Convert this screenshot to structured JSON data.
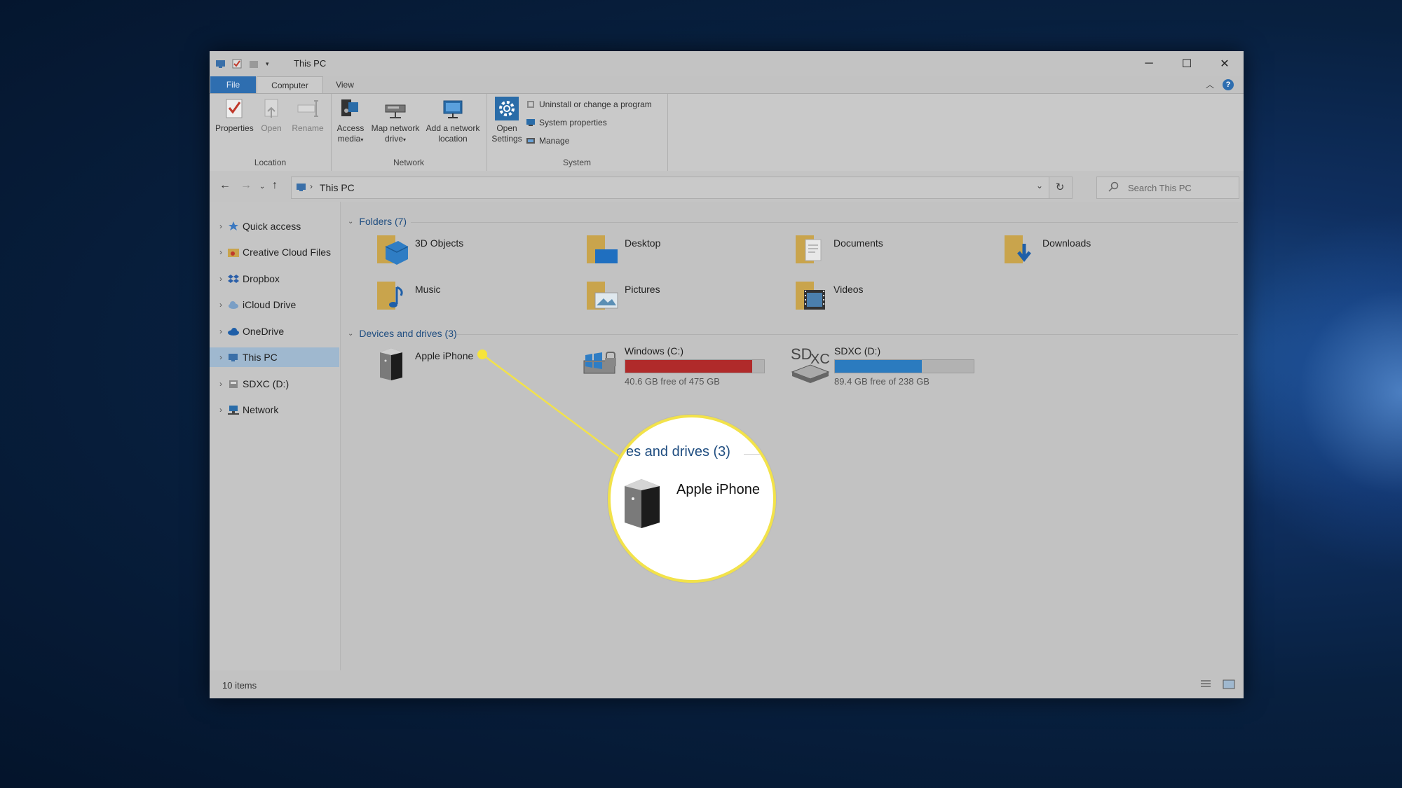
{
  "window": {
    "title": "This PC",
    "minimize_glyph": "─",
    "maximize_glyph": "☐",
    "close_glyph": "✕"
  },
  "ribbon": {
    "tabs": [
      "File",
      "Computer",
      "View"
    ],
    "help_label": "?",
    "location": {
      "label": "Location",
      "buttons": [
        "Properties",
        "Open",
        "Rename"
      ]
    },
    "network": {
      "label": "Network",
      "access_media": "Access media",
      "map_drive": "Map network drive",
      "add_location": "Add a network location"
    },
    "system": {
      "label": "System",
      "open_settings": "Open Settings",
      "uninstall": "Uninstall or change a program",
      "system_properties": "System properties",
      "manage": "Manage"
    }
  },
  "address": {
    "path": "This PC",
    "search_placeholder": "Search This PC"
  },
  "sidebar": {
    "items": [
      "Quick access",
      "Creative Cloud Files",
      "Dropbox",
      "iCloud Drive",
      "OneDrive",
      "This PC",
      "SDXC (D:)",
      "Network"
    ],
    "selected": "This PC"
  },
  "folders": {
    "heading": "Folders (7)",
    "items": [
      "3D Objects",
      "Desktop",
      "Documents",
      "Downloads",
      "Music",
      "Pictures",
      "Videos"
    ]
  },
  "devices": {
    "heading": "Devices and drives (3)",
    "apple_iphone": "Apple iPhone",
    "windows_c": {
      "name": "Windows (C:)",
      "free": "40.6 GB free of 475 GB",
      "used_fraction": 0.915,
      "color": "#b02a2a"
    },
    "sdxc_d": {
      "name": "SDXC (D:)",
      "free": "89.4 GB free of 238 GB",
      "used_fraction": 0.625,
      "color": "#2b7bbf"
    }
  },
  "status": {
    "items": "10 items"
  },
  "callout": {
    "heading": "es and drives (3)",
    "label": "Apple iPhone",
    "ring_color": "#f2e24a"
  }
}
